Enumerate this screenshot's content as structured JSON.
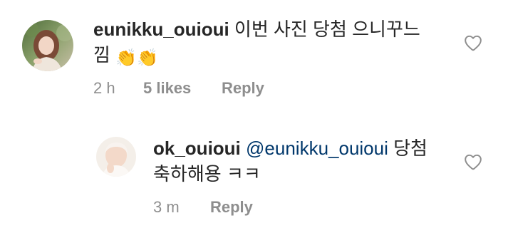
{
  "comments": [
    {
      "username": "eunikku_ouioui",
      "text_line1": "이번 사진 당첨 으니꾸느",
      "text_line2": "낌",
      "emojis": [
        "👏",
        "👏"
      ],
      "time": "2 h",
      "likes": "5 likes",
      "reply_label": "Reply"
    },
    {
      "username": "ok_ouioui",
      "mention": "@eunikku_ouioui",
      "text_line1_rest": "당첨",
      "text_line2": "축하해용 ㅋㅋ",
      "time": "3 m",
      "reply_label": "Reply"
    }
  ],
  "icons": {
    "like": "heart-outline-icon"
  },
  "colors": {
    "text": "#262626",
    "meta": "#8e8e8e",
    "mention": "#00376b"
  }
}
